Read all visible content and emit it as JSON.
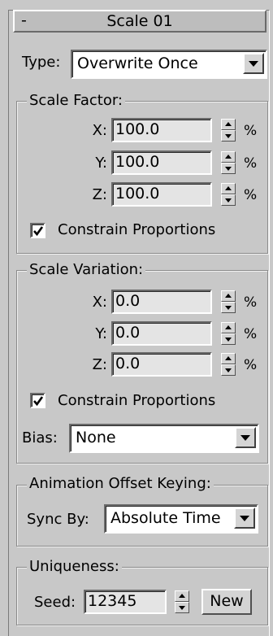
{
  "rollout": {
    "collapse_symbol": "-",
    "title": "Scale 01"
  },
  "type_row": {
    "label": "Type:",
    "selected": "Overwrite Once"
  },
  "scale_factor": {
    "title": "Scale Factor:",
    "fields": [
      {
        "axis": "X:",
        "value": "100.0",
        "unit": "%"
      },
      {
        "axis": "Y:",
        "value": "100.0",
        "unit": "%"
      },
      {
        "axis": "Z:",
        "value": "100.0",
        "unit": "%"
      }
    ],
    "constrain": {
      "label": "Constrain Proportions",
      "checked": true
    }
  },
  "scale_variation": {
    "title": "Scale Variation:",
    "fields": [
      {
        "axis": "X:",
        "value": "0.0",
        "unit": "%"
      },
      {
        "axis": "Y:",
        "value": "0.0",
        "unit": "%"
      },
      {
        "axis": "Z:",
        "value": "0.0",
        "unit": "%"
      }
    ],
    "constrain": {
      "label": "Constrain Proportions",
      "checked": true
    },
    "bias": {
      "label": "Bias:",
      "selected": "None"
    }
  },
  "animation_offset": {
    "title": "Animation Offset Keying:",
    "sync": {
      "label": "Sync By:",
      "selected": "Absolute Time"
    }
  },
  "uniqueness": {
    "title": "Uniqueness:",
    "seed": {
      "label": "Seed:",
      "value": "12345"
    },
    "new_button": "New"
  },
  "colors": {
    "panel_bg": "#c8c8c8",
    "field_bg": "#e4e4e4"
  }
}
